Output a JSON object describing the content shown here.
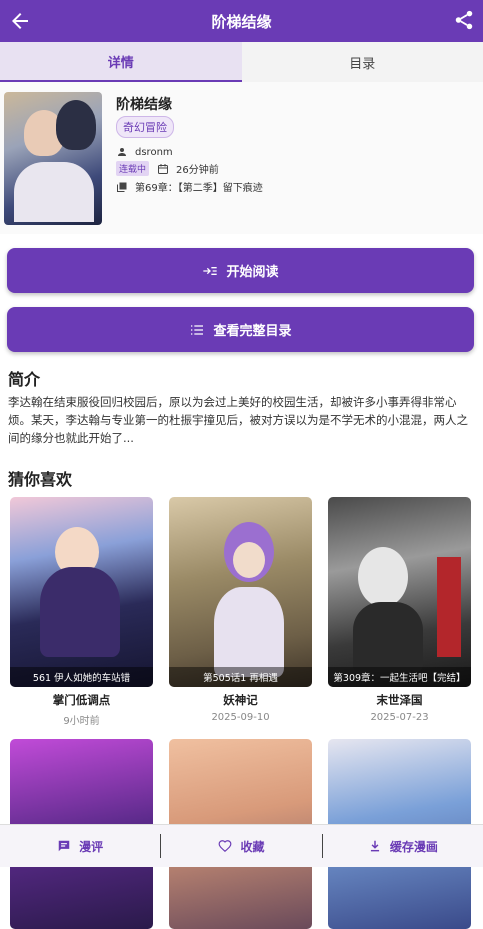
{
  "header": {
    "title": "阶梯结缘",
    "back_icon": "arrow-left-icon",
    "share_icon": "share-icon"
  },
  "tabs": [
    {
      "label": "详情",
      "active": true
    },
    {
      "label": "目录",
      "active": false
    }
  ],
  "book": {
    "title": "阶梯结缘",
    "genre_tag": "奇幻冒险",
    "author": "dsronm",
    "status": "连载中",
    "updated": "26分钟前",
    "latest_chapter": "第69章：【第二季】留下痕迹"
  },
  "actions": {
    "start_reading": "开始阅读",
    "full_catalog": "查看完整目录"
  },
  "intro": {
    "heading": "简介",
    "text": "李达翰在结束服役回归校园后，原以为会过上美好的校园生活，却被许多小事弄得非常心烦。某天，李达翰与专业第一的杜振宇撞见后，被对方误以为是不学无术的小混混，两人之间的缘分也就此开始了..."
  },
  "recommend": {
    "heading": "猜你喜欢",
    "items": [
      {
        "name": "掌门低调点",
        "date": "9小时前",
        "chapter": "561 伊人如她的车站错"
      },
      {
        "name": "妖神记",
        "date": "2025-09-10",
        "chapter": "第505话1 再相遇"
      },
      {
        "name": "末世泽国",
        "date": "2025-07-23",
        "chapter": "第309章：一起生活吧【完结】"
      }
    ]
  },
  "bottom_bar": {
    "comment": "漫评",
    "favorite": "收藏",
    "cache": "缓存漫画"
  },
  "colors": {
    "accent": "#6a3bb5",
    "tab_active_bg": "#e8e1f2"
  }
}
